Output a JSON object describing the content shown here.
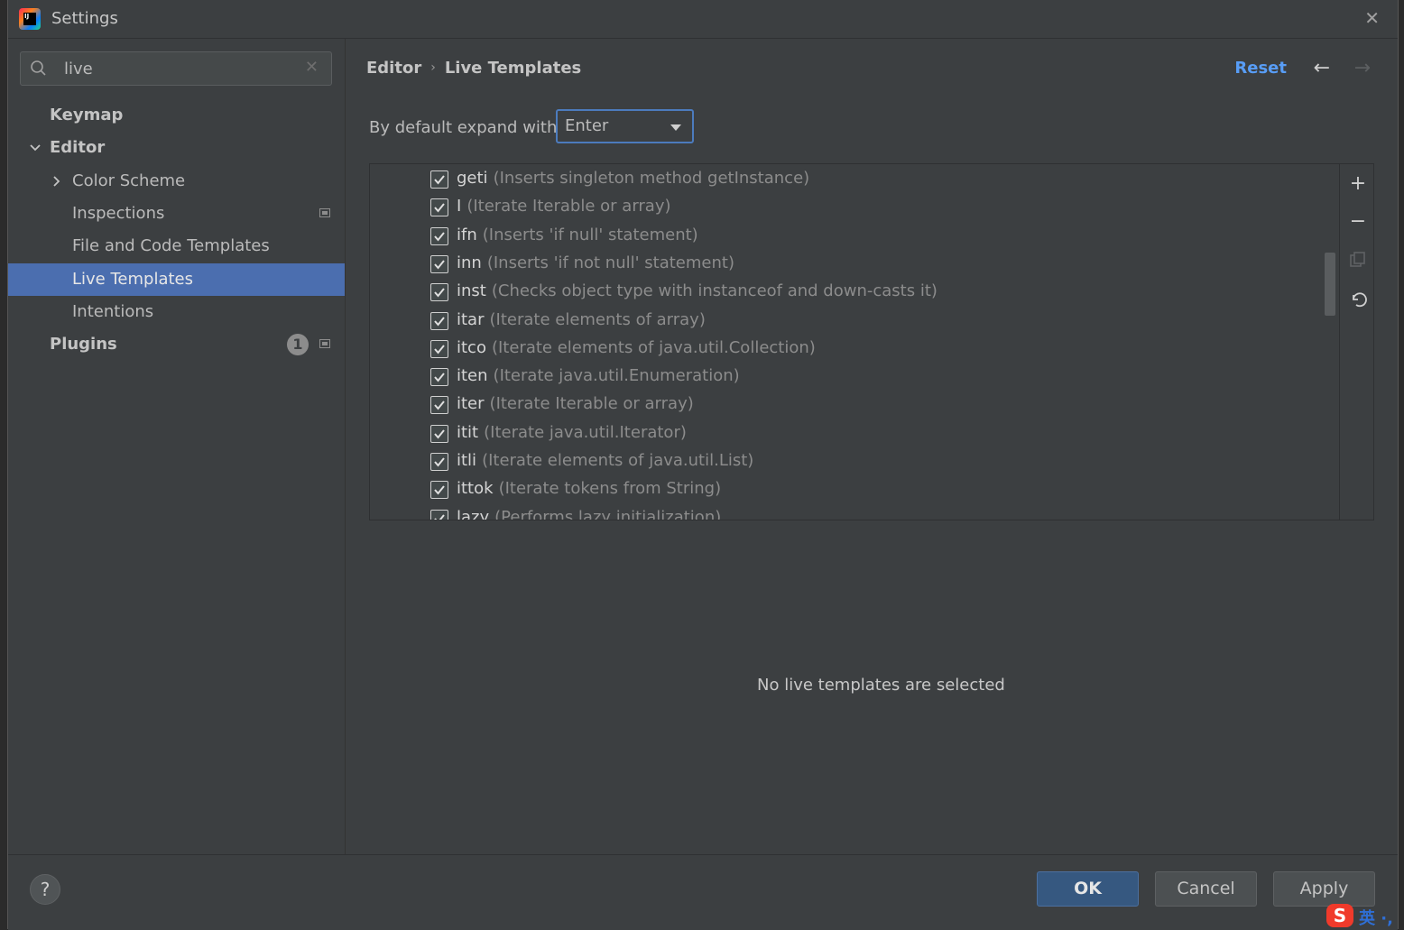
{
  "window": {
    "title": "Settings",
    "close_glyph": "✕"
  },
  "sidebar": {
    "search": {
      "value": "live",
      "placeholder": ""
    },
    "items": [
      {
        "label": "Keymap"
      },
      {
        "label": "Editor"
      },
      {
        "label": "Color Scheme"
      },
      {
        "label": "Inspections"
      },
      {
        "label": "File and Code Templates"
      },
      {
        "label": "Live Templates"
      },
      {
        "label": "Intentions"
      },
      {
        "label": "Plugins",
        "badge": "1"
      }
    ]
  },
  "header": {
    "breadcrumb": [
      "Editor",
      "Live Templates"
    ],
    "reset_label": "Reset"
  },
  "expand": {
    "label": "By default expand with",
    "value": "Enter"
  },
  "templates": [
    {
      "abbr": "geti",
      "desc": "(Inserts singleton method getInstance)"
    },
    {
      "abbr": "I",
      "desc": "(Iterate Iterable or array)"
    },
    {
      "abbr": "ifn",
      "desc": "(Inserts 'if null' statement)"
    },
    {
      "abbr": "inn",
      "desc": "(Inserts 'if not null' statement)"
    },
    {
      "abbr": "inst",
      "desc": "(Checks object type with instanceof and down-casts it)"
    },
    {
      "abbr": "itar",
      "desc": "(Iterate elements of array)"
    },
    {
      "abbr": "itco",
      "desc": "(Iterate elements of java.util.Collection)"
    },
    {
      "abbr": "iten",
      "desc": "(Iterate java.util.Enumeration)"
    },
    {
      "abbr": "iter",
      "desc": "(Iterate Iterable or array)"
    },
    {
      "abbr": "itit",
      "desc": "(Iterate java.util.Iterator)"
    },
    {
      "abbr": "itli",
      "desc": "(Iterate elements of java.util.List)"
    },
    {
      "abbr": "ittok",
      "desc": "(Iterate tokens from String)"
    },
    {
      "abbr": "lazy",
      "desc": "(Performs lazy initialization)"
    }
  ],
  "empty_message": "No live templates are selected",
  "footer": {
    "help_label": "?",
    "ok_label": "OK",
    "cancel_label": "Cancel",
    "apply_label": "Apply"
  },
  "ime": {
    "logo": "S",
    "text": "英 ·,"
  },
  "colors": {
    "selection": "#4b6eaf",
    "link": "#589df6",
    "ok_button": "#365880"
  }
}
